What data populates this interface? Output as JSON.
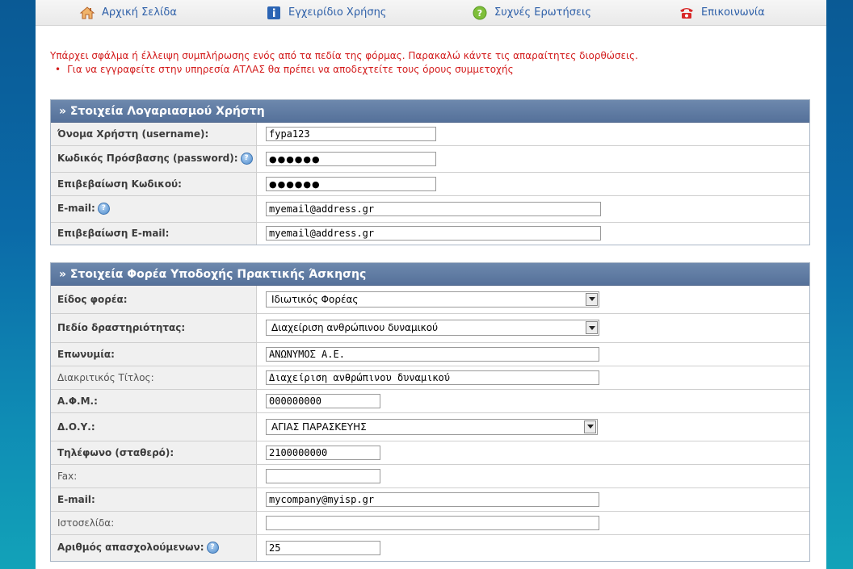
{
  "nav": {
    "home": "Αρχική Σελίδα",
    "manual": "Εγχειρίδιο Χρήσης",
    "faq": "Συχνές Ερωτήσεις",
    "contact": "Επικοινωνία"
  },
  "errors": {
    "main": "Υπάρχει σφάλμα ή έλλειψη συμπλήρωσης ενός από τα πεδία της φόρμας. Παρακαλώ κάντε τις απαραίτητες διορθώσεις.",
    "item1": "Για να εγγραφείτε στην υπηρεσία ΑΤΛΑΣ θα πρέπει να αποδεχτείτε τους όρους συμμετοχής"
  },
  "account": {
    "title": "» Στοιχεία Λογαριασμού Χρήστη",
    "username_label": "Όνομα Χρήστη (username):",
    "username_value": "fypa123",
    "password_label": "Κωδικός Πρόσβασης (password):",
    "password_value": "●●●●●●",
    "password_confirm_label": "Επιβεβαίωση Κωδικού:",
    "password_confirm_value": "●●●●●●",
    "email_label": "E-mail:",
    "email_value": "myemail@address.gr",
    "email_confirm_label": "Επιβεβαίωση E-mail:",
    "email_confirm_value": "myemail@address.gr"
  },
  "org": {
    "title": "» Στοιχεία Φορέα Υποδοχής Πρακτικής Άσκησης",
    "type_label": "Είδος φορέα:",
    "type_value": "Ιδιωτικός Φορέας",
    "field_label": "Πεδίο δραστηριότητας:",
    "field_value": "Διαχείριση ανθρώπινου δυναμικού",
    "name_label": "Επωνυμία:",
    "name_value": "ΑΝΩΝΥΜΟΣ Α.Ε.",
    "distinct_label": "Διακριτικός Τίτλος:",
    "distinct_value": "Διαχείριση ανθρώπινου δυναμικού",
    "afm_label": "Α.Φ.Μ.:",
    "afm_value": "000000000",
    "doy_label": "Δ.Ο.Υ.:",
    "doy_value": "ΑΓΙΑΣ ΠΑΡΑΣΚΕΥΗΣ",
    "phone_label": "Τηλέφωνο (σταθερό):",
    "phone_value": "2100000000",
    "fax_label": "Fax:",
    "fax_value": "",
    "email_label": "E-mail:",
    "email_value": "mycompany@myisp.gr",
    "website_label": "Ιστοσελίδα:",
    "website_value": "",
    "employees_label": "Αριθμός απασχολούμενων:",
    "employees_value": "25"
  },
  "help_glyph": "?"
}
